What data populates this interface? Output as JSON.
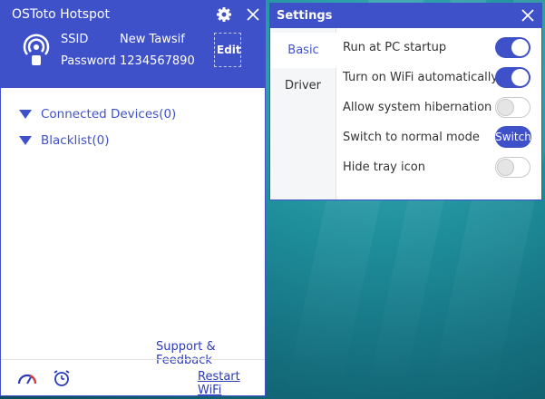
{
  "hotspot": {
    "title": "OSToto Hotspot",
    "ssid_label": "SSID",
    "ssid_value": "New Tawsif",
    "password_label": "Password",
    "password_value": "1234567890",
    "edit_label": "Edit",
    "connected_devices": "Connected Devices(0)",
    "blacklist": "Blacklist(0)",
    "support_link": "Support & Feedback",
    "restart_link": "Restart WiFi"
  },
  "settings": {
    "title": "Settings",
    "tabs": [
      {
        "label": "Basic",
        "active": true
      },
      {
        "label": "Driver",
        "active": false
      }
    ],
    "options": [
      {
        "label": "Run at PC startup",
        "control": "toggle",
        "on": true
      },
      {
        "label": "Turn on WiFi automatically",
        "control": "toggle",
        "on": true
      },
      {
        "label": "Allow system hibernation",
        "control": "toggle",
        "on": false
      },
      {
        "label": "Switch to normal mode",
        "control": "button",
        "button_label": "Switch"
      },
      {
        "label": "Hide tray icon",
        "control": "toggle",
        "on": false
      }
    ]
  },
  "colors": {
    "accent": "#3f51c9",
    "link": "#2b3bb8"
  },
  "icons": [
    "gear-icon",
    "close-icon",
    "hotspot-icon",
    "speedometer-icon",
    "alarm-clock-icon"
  ]
}
